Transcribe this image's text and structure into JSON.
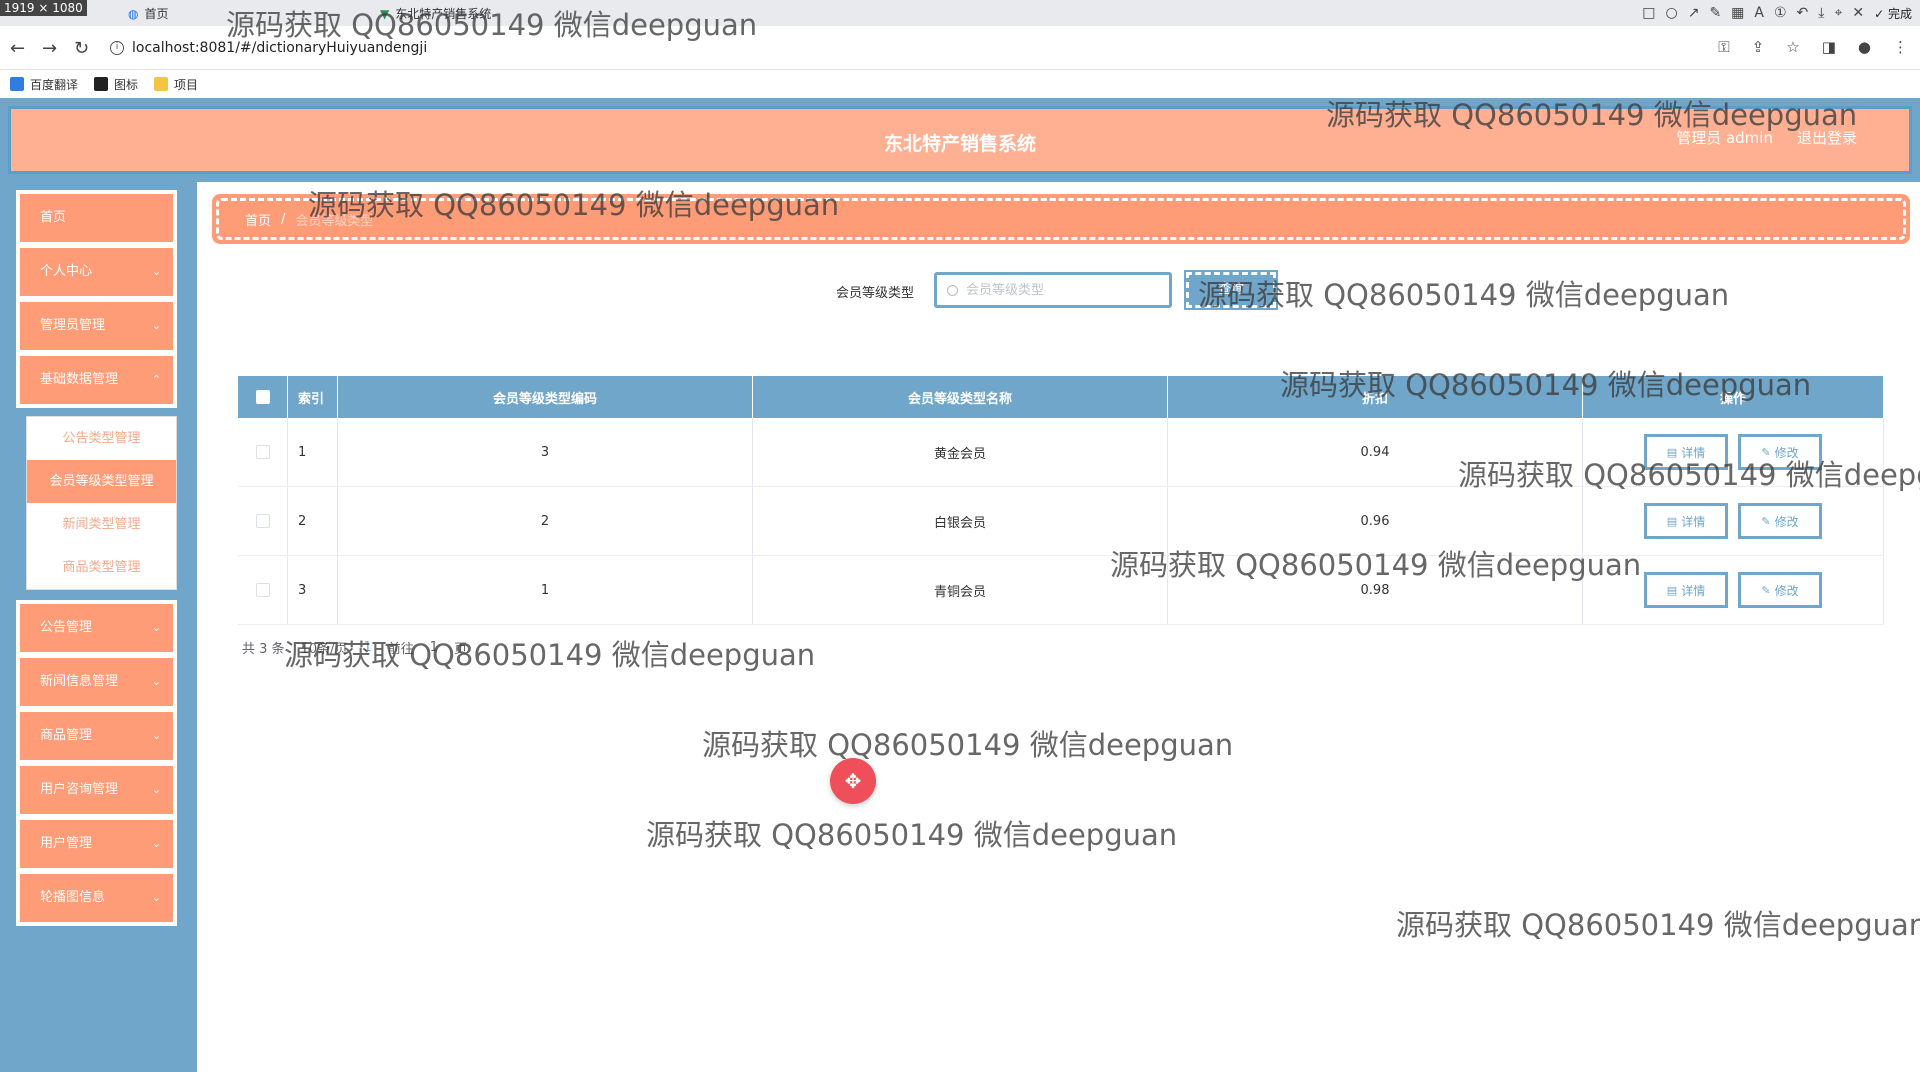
{
  "browser": {
    "resolution": "1919 × 1080",
    "tabs": [
      {
        "title": "首页"
      },
      {
        "title": "东北特产销售系统"
      }
    ],
    "toolbar_done": "完成",
    "url": "localhost:8081/#/dictionaryHuiyuandengji",
    "bookmarks": [
      {
        "label": "百度翻译",
        "color": "#2f7de1"
      },
      {
        "label": "图标",
        "color": "#222222"
      },
      {
        "label": "项目",
        "color": "#f4c542"
      }
    ]
  },
  "header": {
    "title": "东北特产销售系统",
    "user": "管理员 admin",
    "logout": "退出登录"
  },
  "sidebar": {
    "items": [
      {
        "label": "首页",
        "has_sub": false
      },
      {
        "label": "个人中心",
        "has_sub": true
      },
      {
        "label": "管理员管理",
        "has_sub": true
      },
      {
        "label": "基础数据管理",
        "has_sub": true
      },
      {
        "label": "公告管理",
        "has_sub": true
      },
      {
        "label": "新闻信息管理",
        "has_sub": true
      },
      {
        "label": "商品管理",
        "has_sub": true
      },
      {
        "label": "用户咨询管理",
        "has_sub": true
      },
      {
        "label": "用户管理",
        "has_sub": true
      },
      {
        "label": "轮播图信息",
        "has_sub": true
      }
    ],
    "submenu": [
      {
        "label": "公告类型管理"
      },
      {
        "label": "会员等级类型管理"
      },
      {
        "label": "新闻类型管理"
      },
      {
        "label": "商品类型管理"
      }
    ]
  },
  "breadcrumb": {
    "home": "首页",
    "sep": "/",
    "current": "会员等级类型"
  },
  "search": {
    "label": "会员等级类型",
    "placeholder": "会员等级类型",
    "button": "查询"
  },
  "table": {
    "headers": {
      "index": "索引",
      "code": "会员等级类型编码",
      "name": "会员等级类型名称",
      "discount": "折扣",
      "ops": "操作"
    },
    "rows": [
      {
        "index": "1",
        "code": "3",
        "name": "黄金会员",
        "discount": "0.94"
      },
      {
        "index": "2",
        "code": "2",
        "name": "白银会员",
        "discount": "0.96"
      },
      {
        "index": "3",
        "code": "1",
        "name": "青铜会员",
        "discount": "0.98"
      }
    ],
    "detail_label": "详情",
    "edit_label": "修改"
  },
  "pager": {
    "total": "共 3 条",
    "page_size": "10条/页",
    "page": "1",
    "goto": "前往",
    "goto_page": "1",
    "suffix": "页"
  },
  "watermark": "源码获取 QQ86050149 微信deepguan",
  "colors": {
    "primary": "#6fa6c9",
    "accent": "#ff9c78",
    "header_bg": "#ffb093"
  }
}
